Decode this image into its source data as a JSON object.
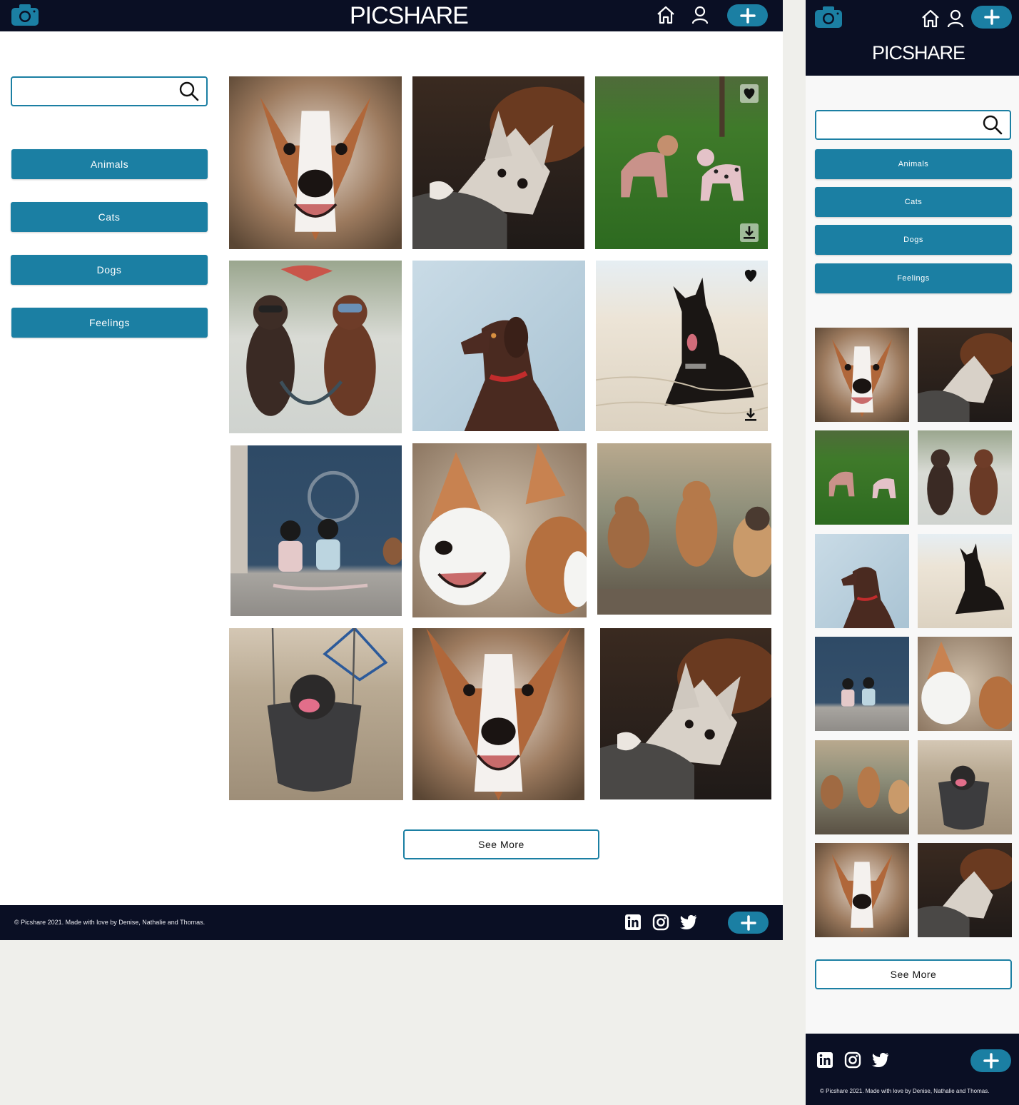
{
  "brand": {
    "name": "PICSHARE"
  },
  "search": {
    "placeholder": ""
  },
  "categories": [
    {
      "label": "Animals"
    },
    {
      "label": "Cats"
    },
    {
      "label": "Dogs"
    },
    {
      "label": "Feelings"
    }
  ],
  "see_more": {
    "label": "See More"
  },
  "footer": {
    "copyright": "© Picshare 2021. Made with love by Denise, Nathalie and Thomas."
  },
  "photos": [
    "dog-face-closeup",
    "husky-puppy-on-couch",
    "two-dogs-on-grass",
    "poodles-with-sunglasses",
    "brown-labrador",
    "shepherd-on-beach",
    "boston-terriers-in-sweaters",
    "corgi-selfie",
    "three-puppies",
    "pug-in-swing",
    "dog-face-closeup",
    "husky-puppy-on-couch"
  ],
  "colors": {
    "accent": "#1b7fa3",
    "navbar": "#0a0f24",
    "page_bg": "#efefeb"
  },
  "icons": [
    "camera-icon",
    "home-icon",
    "user-icon",
    "plus-icon",
    "search-icon",
    "heart-icon",
    "download-icon",
    "linkedin-icon",
    "instagram-icon",
    "twitter-icon"
  ]
}
